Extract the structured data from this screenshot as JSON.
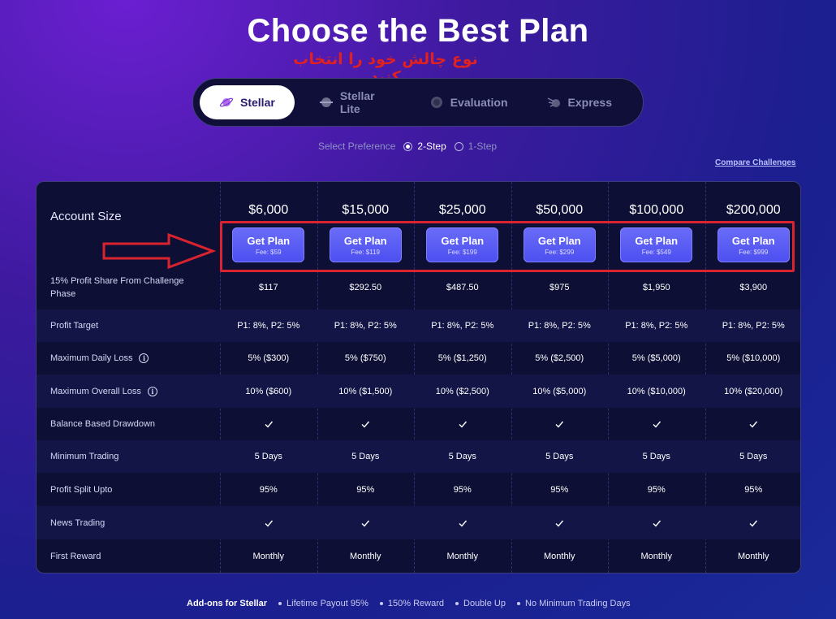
{
  "title": "Choose the Best Plan",
  "annotation_text": "نوع چالش خود را انتخاب کنید",
  "tabs": [
    {
      "label": "Stellar",
      "active": true,
      "icon": "planet-icon"
    },
    {
      "label": "Stellar Lite",
      "active": false,
      "icon": "saturn-icon"
    },
    {
      "label": "Evaluation",
      "active": false,
      "icon": "moon-icon"
    },
    {
      "label": "Express",
      "active": false,
      "icon": "comet-icon"
    }
  ],
  "preference": {
    "label": "Select Preference",
    "options": [
      {
        "label": "2-Step",
        "selected": true
      },
      {
        "label": "1-Step",
        "selected": false
      }
    ]
  },
  "compare_link": "Compare Challenges",
  "table": {
    "account_size_label": "Account Size",
    "plans": [
      {
        "price": "$6,000",
        "button": "Get Plan",
        "fee": "Fee: $59"
      },
      {
        "price": "$15,000",
        "button": "Get Plan",
        "fee": "Fee: $119"
      },
      {
        "price": "$25,000",
        "button": "Get Plan",
        "fee": "Fee: $199"
      },
      {
        "price": "$50,000",
        "button": "Get Plan",
        "fee": "Fee: $299"
      },
      {
        "price": "$100,000",
        "button": "Get Plan",
        "fee": "Fee: $549"
      },
      {
        "price": "$200,000",
        "button": "Get Plan",
        "fee": "Fee: $999"
      }
    ],
    "rows": [
      {
        "label": "15% Profit Share From Challenge Phase",
        "info": false,
        "values": [
          "$117",
          "$292.50",
          "$487.50",
          "$975",
          "$1,950",
          "$3,900"
        ]
      },
      {
        "label": "Profit Target",
        "info": false,
        "values": [
          "P1: 8%, P2: 5%",
          "P1: 8%, P2: 5%",
          "P1: 8%, P2: 5%",
          "P1: 8%, P2: 5%",
          "P1: 8%, P2: 5%",
          "P1: 8%, P2: 5%"
        ]
      },
      {
        "label": "Maximum Daily Loss",
        "info": true,
        "values": [
          "5% ($300)",
          "5% ($750)",
          "5% ($1,250)",
          "5% ($2,500)",
          "5% ($5,000)",
          "5% ($10,000)"
        ]
      },
      {
        "label": "Maximum Overall Loss",
        "info": true,
        "values": [
          "10% ($600)",
          "10% ($1,500)",
          "10% ($2,500)",
          "10% ($5,000)",
          "10% ($10,000)",
          "10% ($20,000)"
        ]
      },
      {
        "label": "Balance Based Drawdown",
        "info": false,
        "check": true,
        "values": [
          "",
          "",
          "",
          "",
          "",
          ""
        ]
      },
      {
        "label": "Minimum Trading",
        "info": false,
        "values": [
          "5 Days",
          "5 Days",
          "5 Days",
          "5 Days",
          "5 Days",
          "5 Days"
        ]
      },
      {
        "label": "Profit Split Upto",
        "info": false,
        "values": [
          "95%",
          "95%",
          "95%",
          "95%",
          "95%",
          "95%"
        ]
      },
      {
        "label": "News Trading",
        "info": false,
        "check": true,
        "values": [
          "",
          "",
          "",
          "",
          "",
          ""
        ]
      },
      {
        "label": "First Reward",
        "info": false,
        "values": [
          "Monthly",
          "Monthly",
          "Monthly",
          "Monthly",
          "Monthly",
          "Monthly"
        ]
      }
    ]
  },
  "addons": {
    "heading": "Add-ons for Stellar",
    "items": [
      "Lifetime Payout 95%",
      "150% Reward",
      "Double Up",
      "No Minimum Trading Days"
    ]
  },
  "colors": {
    "accent_button": "#5557f2",
    "annotation_red": "#d9232e"
  }
}
